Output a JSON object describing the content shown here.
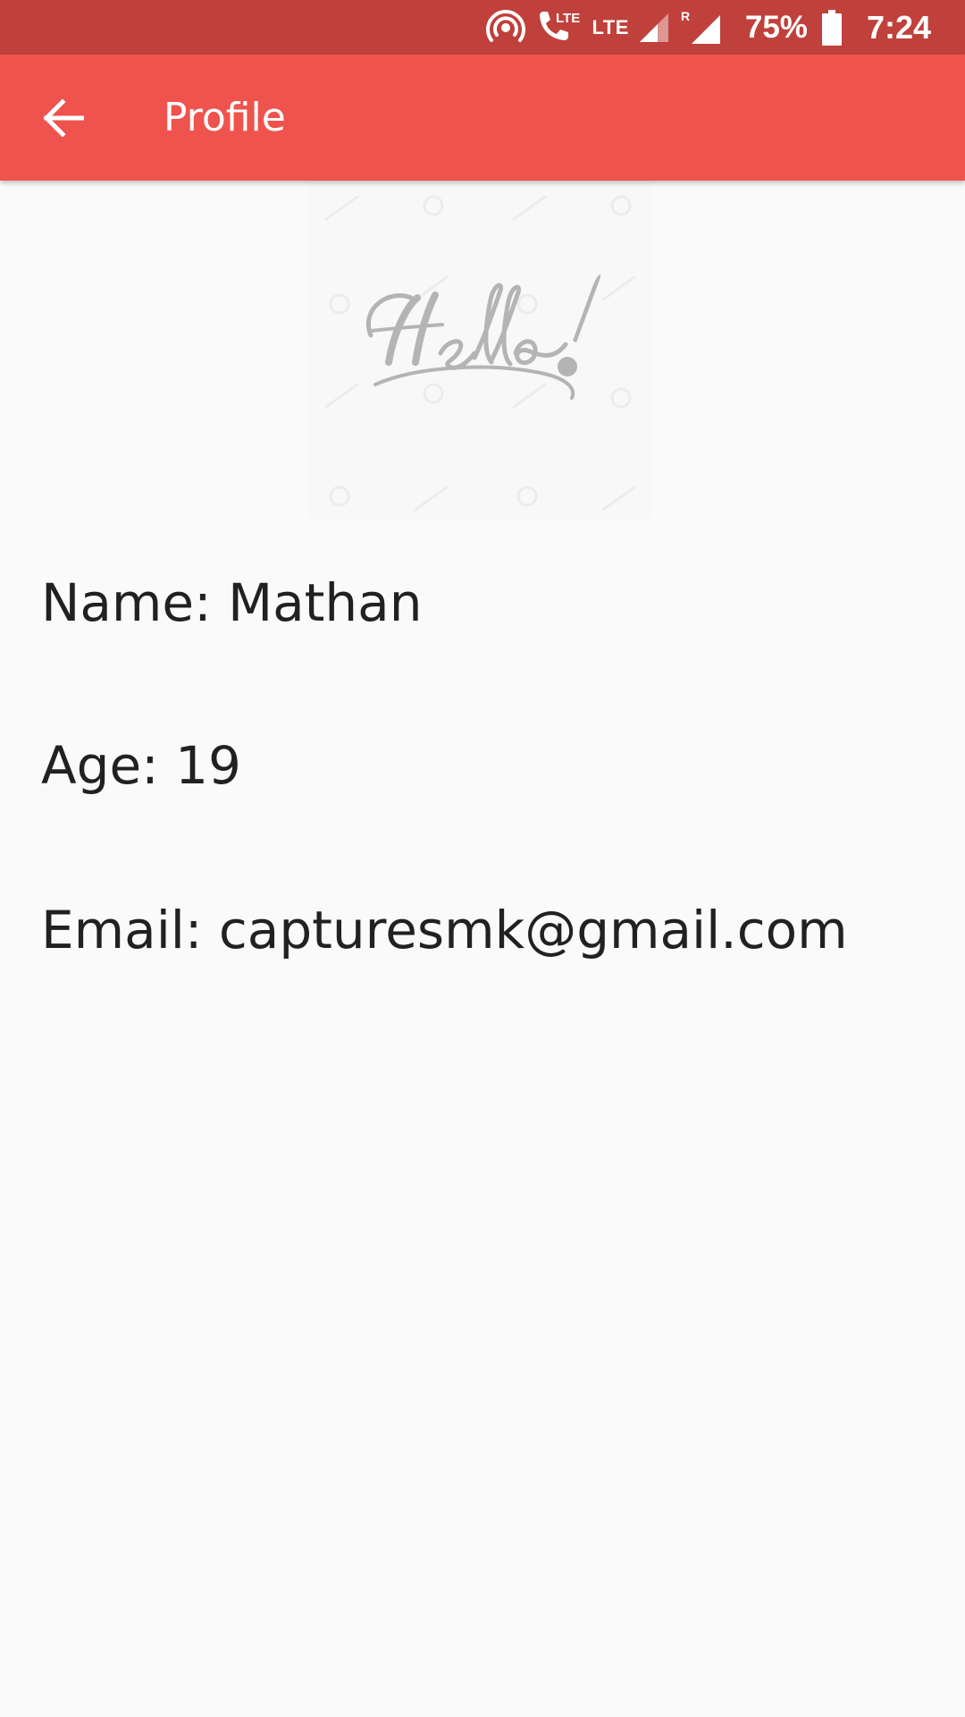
{
  "status_bar": {
    "network_label_1": "LTE",
    "network_label_2": "LTE",
    "roaming_indicator": "R",
    "battery_percent": "75%",
    "time": "7:24",
    "icons": [
      "hotspot-icon",
      "volte-call-icon",
      "signal-icon",
      "roaming-signal-icon",
      "battery-icon"
    ],
    "background_color": "#c0403b"
  },
  "app_bar": {
    "title": "Profile",
    "back_icon": "arrow-left-icon",
    "background_color": "#ef534d"
  },
  "profile": {
    "image_text": "Hello!",
    "name": "Name: Mathan",
    "age": "Age: 19",
    "email": "Email: capturesmk@gmail.com"
  }
}
